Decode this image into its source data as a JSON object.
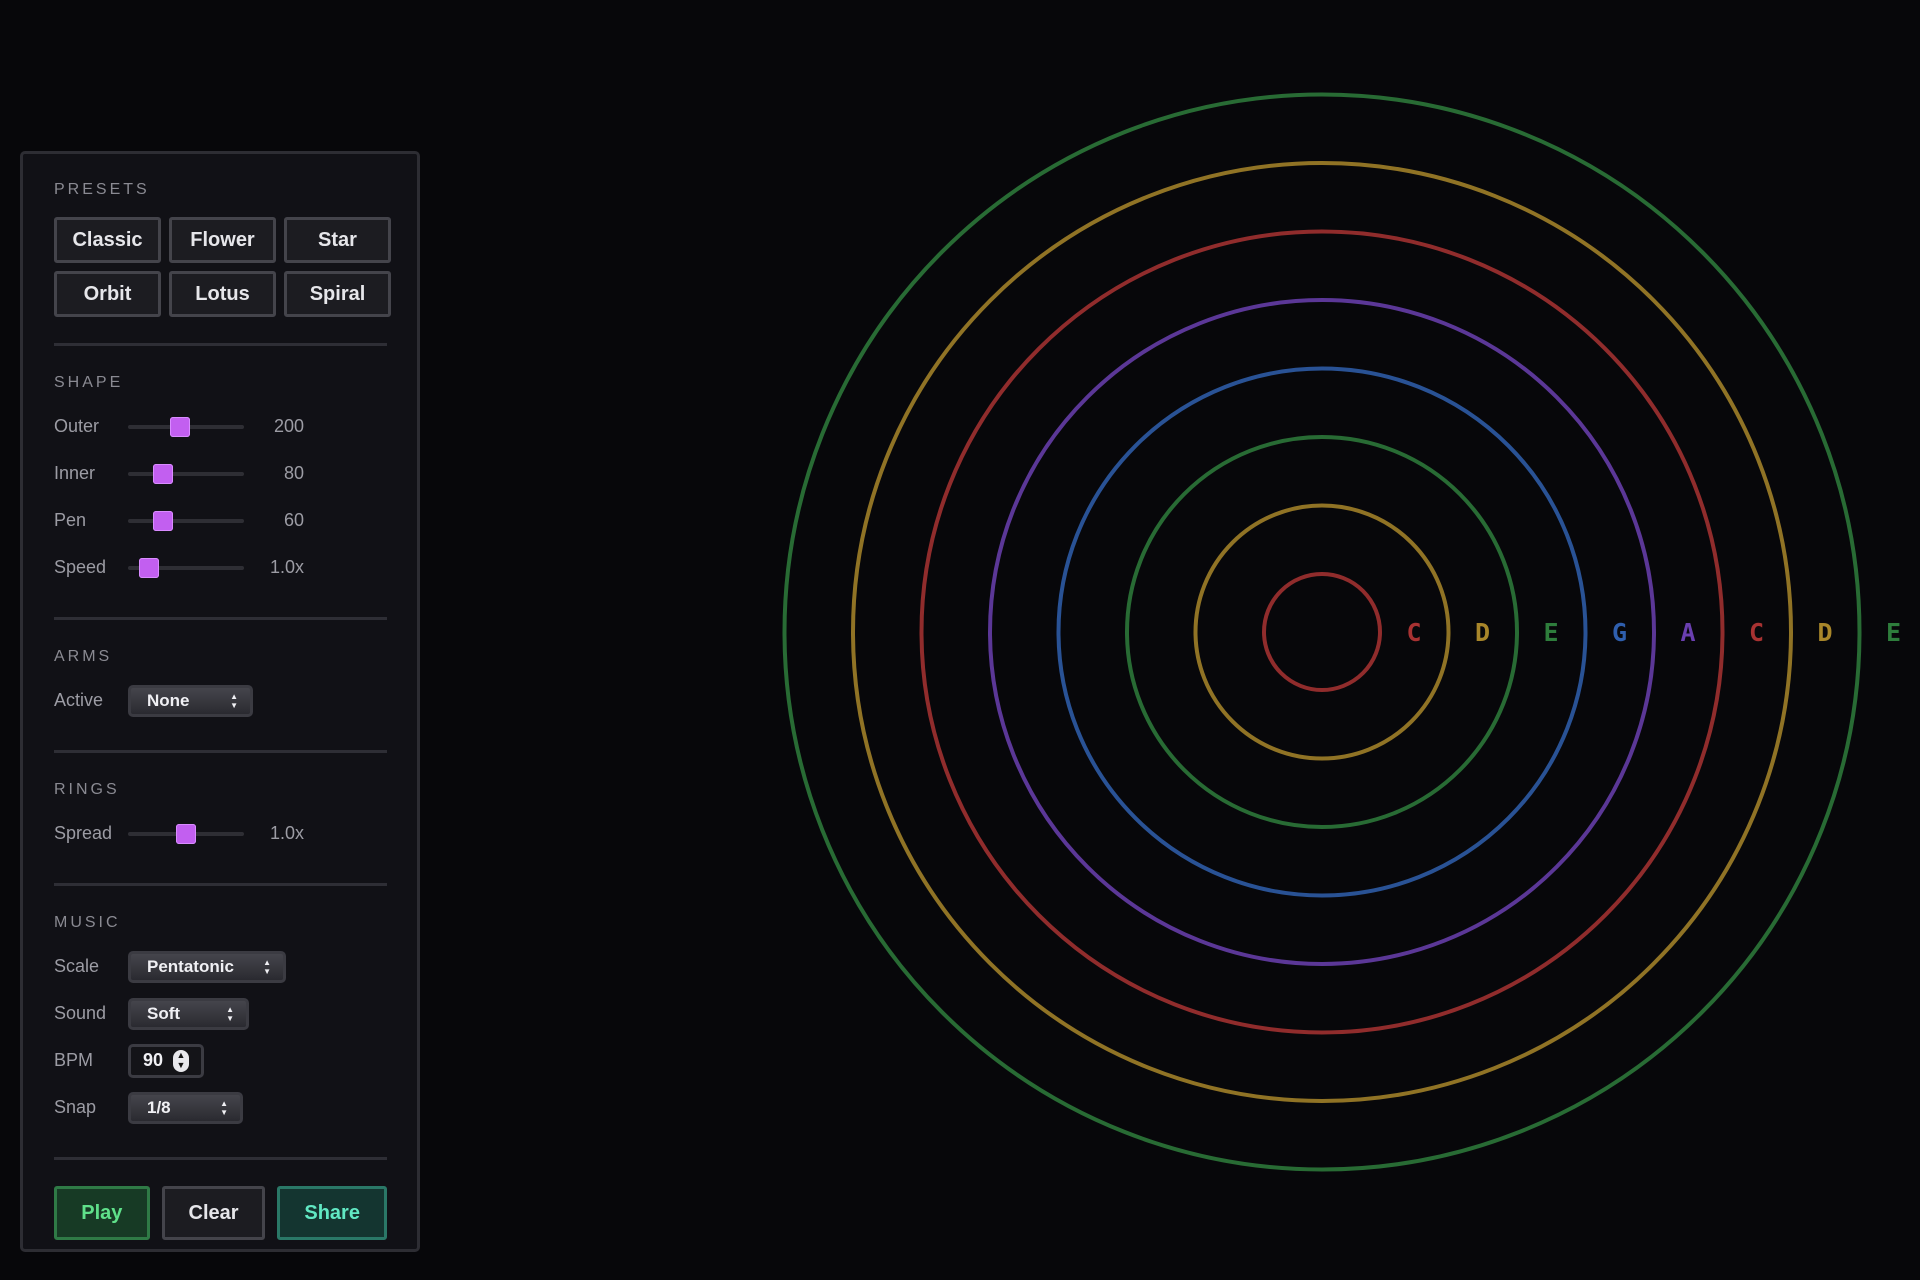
{
  "presets": {
    "title": "PRESETS",
    "buttons": [
      "Classic",
      "Flower",
      "Star",
      "Orbit",
      "Lotus",
      "Spiral"
    ]
  },
  "shape": {
    "title": "SHAPE",
    "outer": {
      "label": "Outer",
      "value_text": "200",
      "fraction": 0.45
    },
    "inner": {
      "label": "Inner",
      "value_text": "80",
      "fraction": 0.3
    },
    "pen": {
      "label": "Pen",
      "value_text": "60",
      "fraction": 0.3
    },
    "speed": {
      "label": "Speed",
      "value_text": "1.0x",
      "fraction": 0.18
    }
  },
  "arms": {
    "title": "ARMS",
    "active_label": "Active",
    "active_value": "None"
  },
  "rings_section": {
    "title": "RINGS",
    "spread": {
      "label": "Spread",
      "value_text": "1.0x",
      "fraction": 0.5
    }
  },
  "music": {
    "title": "MUSIC",
    "scale_label": "Scale",
    "scale_value": "Pentatonic",
    "sound_label": "Sound",
    "sound_value": "Soft",
    "bpm_label": "BPM",
    "bpm_value": "90",
    "snap_label": "Snap",
    "snap_value": "1/8"
  },
  "actions": {
    "play": "Play",
    "clear": "Clear",
    "share": "Share"
  },
  "canvas": {
    "notes": [
      {
        "note": "C",
        "color": "#a83232"
      },
      {
        "note": "D",
        "color": "#a8862a"
      },
      {
        "note": "E",
        "color": "#2e7d3c"
      },
      {
        "note": "G",
        "color": "#2f5fae"
      },
      {
        "note": "A",
        "color": "#6a3fb0"
      },
      {
        "note": "C",
        "color": "#a83232"
      },
      {
        "note": "D",
        "color": "#a8862a"
      },
      {
        "note": "E",
        "color": "#2e7d3c"
      }
    ],
    "accent_color": "#c25ff0"
  }
}
